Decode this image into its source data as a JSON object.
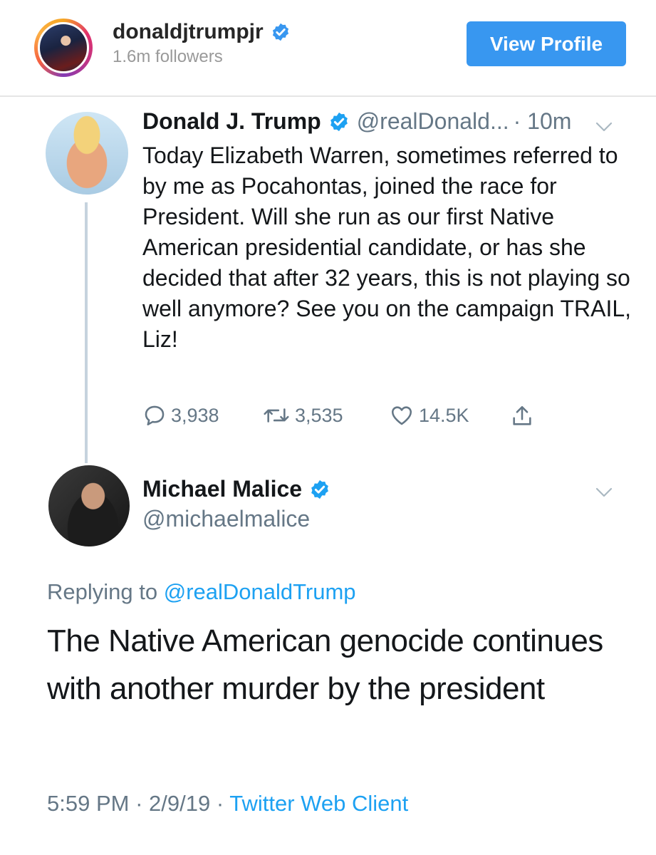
{
  "instagram_header": {
    "username": "donaldjtrumpjr",
    "followers": "1.6m followers",
    "view_profile_label": "View Profile"
  },
  "tweet1": {
    "name": "Donald J. Trump",
    "handle": "@realDonald...",
    "time": "· 10m",
    "text": "Today Elizabeth Warren, sometimes referred to by me as Pocahontas, joined the race for President. Will she run as our first Native American presidential candidate, or has she decided that after 32 years, this is not playing so well anymore? See you on the campaign TRAIL, Liz!",
    "replies": "3,938",
    "retweets": "3,535",
    "likes": "14.5K"
  },
  "tweet2": {
    "name": "Michael Malice",
    "handle": "@michaelmalice",
    "replying_prefix": "Replying to",
    "replying_to": "@realDonaldTrump",
    "text": "The Native American genocide continues with another murder by the president",
    "time": "5:59 PM",
    "date": "2/9/19",
    "client": "Twitter Web Client"
  },
  "colors": {
    "twitter_blue": "#1da1f2",
    "instagram_blue": "#3897f0",
    "secondary_text": "#657786"
  },
  "icons": [
    "verified-badge-icon",
    "chevron-down-icon",
    "reply-icon",
    "retweet-icon",
    "like-icon",
    "share-icon"
  ]
}
